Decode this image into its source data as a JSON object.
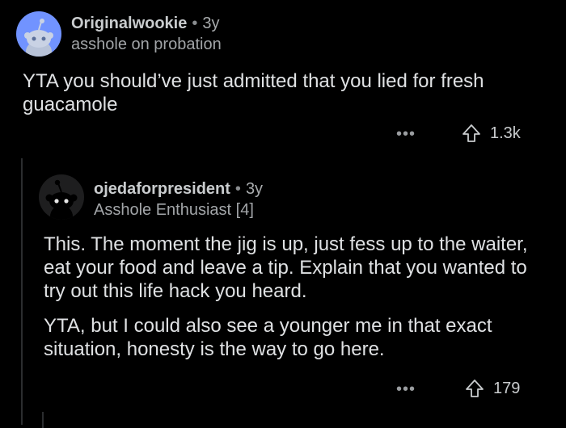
{
  "comments": [
    {
      "author": "Originalwookie",
      "separator": "•",
      "age": "3y",
      "flair": "asshole on probation",
      "paragraphs": [
        "YTA you should’ve just admitted that you lied for fresh guacamole"
      ],
      "more_label": "•••",
      "score": "1.3k",
      "avatar_icon": "reddit-snoo-icon",
      "avatar_color": "#7193ff"
    },
    {
      "author": "ojedaforpresident",
      "separator": "•",
      "age": "3y",
      "flair": "Asshole Enthusiast [4]",
      "paragraphs": [
        "This. The moment the jig is up, just fess up to the waiter, eat your food and leave a tip. Explain that you wanted to try out this life hack you heard.",
        "YTA, but I could also see a younger me in that exact situation, honesty is the way to go here."
      ],
      "more_label": "•••",
      "score": "179",
      "avatar_icon": "reddit-snoo-black-icon",
      "avatar_color": "#1e1e1f"
    }
  ]
}
